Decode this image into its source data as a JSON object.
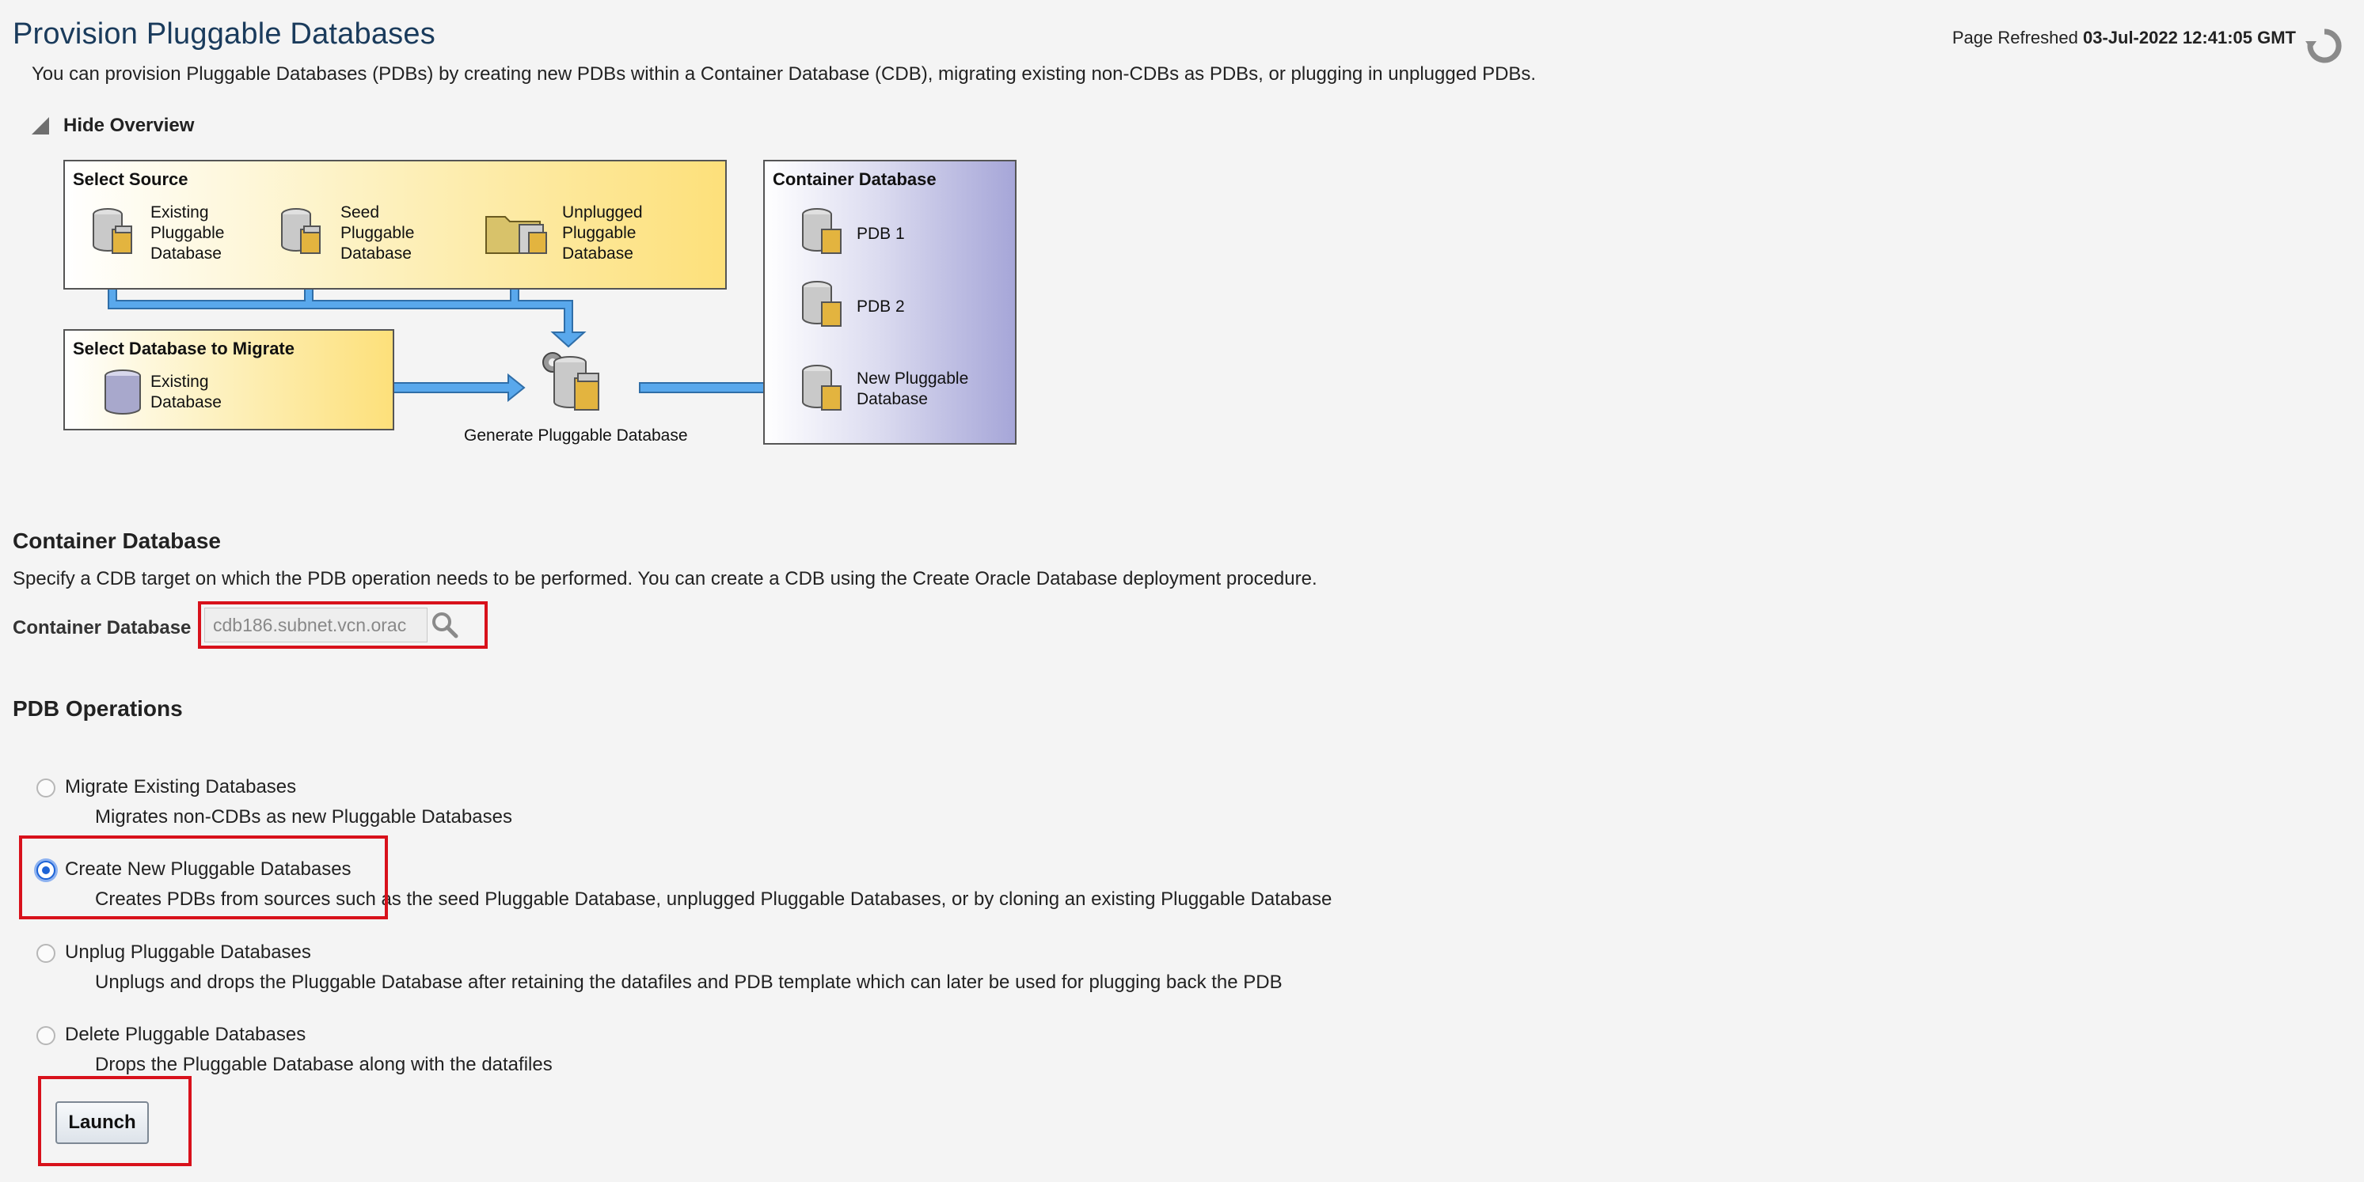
{
  "header": {
    "title": "Provision Pluggable Databases",
    "intro": "You can provision Pluggable Databases (PDBs) by creating new PDBs within a Container Database (CDB), migrating existing non-CDBs as PDBs, or plugging in unplugged PDBs.",
    "refreshed_label": "Page Refreshed",
    "refreshed_value": "03-Jul-2022 12:41:05 GMT"
  },
  "overview": {
    "toggle_label": "Hide Overview",
    "select_source": {
      "title": "Select Source",
      "items": [
        {
          "lines": [
            "Existing",
            "Pluggable",
            "Database"
          ],
          "icon": "database-icon"
        },
        {
          "lines": [
            "Seed",
            "Pluggable",
            "Database"
          ],
          "icon": "database-icon"
        },
        {
          "lines": [
            "Unplugged",
            "Pluggable",
            "Database"
          ],
          "icon": "folder-database-icon"
        }
      ]
    },
    "select_migrate": {
      "title": "Select Database to Migrate",
      "item_lines": [
        "Existing",
        "Database"
      ]
    },
    "generate_label": "Generate Pluggable Database",
    "container": {
      "title": "Container Database",
      "items": [
        {
          "lines": [
            "PDB 1"
          ]
        },
        {
          "lines": [
            "PDB 2"
          ]
        },
        {
          "lines": [
            "New Pluggable",
            "Database"
          ]
        }
      ]
    }
  },
  "container_section": {
    "heading": "Container Database",
    "description": "Specify a CDB target on which the PDB operation needs to be performed. You can create a CDB using the Create Oracle Database deployment procedure.",
    "field_label": "Container Database",
    "field_value": "cdb186.subnet.vcn.orac"
  },
  "pdb_operations": {
    "heading": "PDB Operations",
    "options": [
      {
        "label": "Migrate Existing Databases",
        "description": "Migrates non-CDBs as new Pluggable Databases",
        "selected": false
      },
      {
        "label": "Create New Pluggable Databases",
        "description": "Creates PDBs from sources such as the seed Pluggable Database, unplugged Pluggable Databases, or by cloning an existing Pluggable Database",
        "selected": true
      },
      {
        "label": "Unplug Pluggable Databases",
        "description": "Unplugs and drops the Pluggable Database after retaining the datafiles and PDB template which can later be used for plugging back the PDB",
        "selected": false
      },
      {
        "label": "Delete Pluggable Databases",
        "description": "Drops the Pluggable Database along with the datafiles",
        "selected": false
      }
    ],
    "launch_label": "Launch"
  },
  "colors": {
    "title": "#1a3b5c",
    "highlight": "#d8111b",
    "arrow": "#4a9be0",
    "radio_selected": "#1d63d6"
  }
}
